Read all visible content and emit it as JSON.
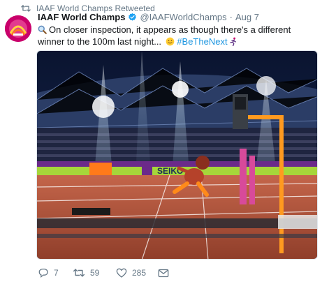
{
  "retweet_context": {
    "text": "IAAF World Champs Retweeted",
    "icon": "retweet-icon"
  },
  "tweet": {
    "author": {
      "display_name": "IAAF World Champs",
      "handle": "@IAAFWorldChamps",
      "verified": true,
      "avatar": "avatar-icon",
      "avatar_color": "#c9006b"
    },
    "separator": "·",
    "date": "Aug 7",
    "text_part1": "On closer inspection, it appears as though there's a different winner to the 100m last night...",
    "hashtag": "#BeTheNext",
    "hashtag_color": "#1b95e0",
    "emojis": [
      "magnifying-glass-icon",
      "smiling-face-icon",
      "runner-icon"
    ],
    "media": {
      "type": "photo",
      "icon": "stadium-photo",
      "board_text": "SEIKO"
    },
    "actions": {
      "reply_count": "7",
      "retweet_count": "59",
      "like_count": "285"
    }
  },
  "colors": {
    "muted": "#657786",
    "verified_blue": "#1da1f2",
    "track": "#b5553a"
  }
}
